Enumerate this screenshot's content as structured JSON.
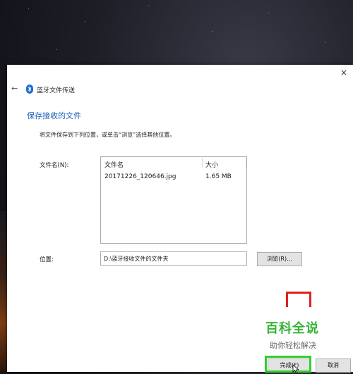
{
  "window": {
    "title": "蓝牙文件传送",
    "close_glyph": "×",
    "back_glyph": "←"
  },
  "main": {
    "heading": "保存接收的文件",
    "instruction": "将文件保存到下列位置，或单击“浏览”选择其他位置。",
    "file_label": "文件名(N):",
    "columns": [
      "文件名",
      "大小"
    ],
    "files": [
      {
        "name": "20171226_120646.jpg",
        "size": "1.65 MB"
      }
    ],
    "location_label": "位置:",
    "location_value": "D:\\蓝牙接收文件的文件夹",
    "browse_label": "浏览(R)..."
  },
  "footer": {
    "finish_label": "完成(F)",
    "cancel_label": "取消"
  },
  "watermark": {
    "title": "百科全说",
    "subtitle": "助你轻松解决"
  },
  "colors": {
    "heading": "#1a5fb4",
    "bluetooth": "#1f6fd1",
    "highlight": "#2fd12f",
    "annotation": "#e02020"
  }
}
